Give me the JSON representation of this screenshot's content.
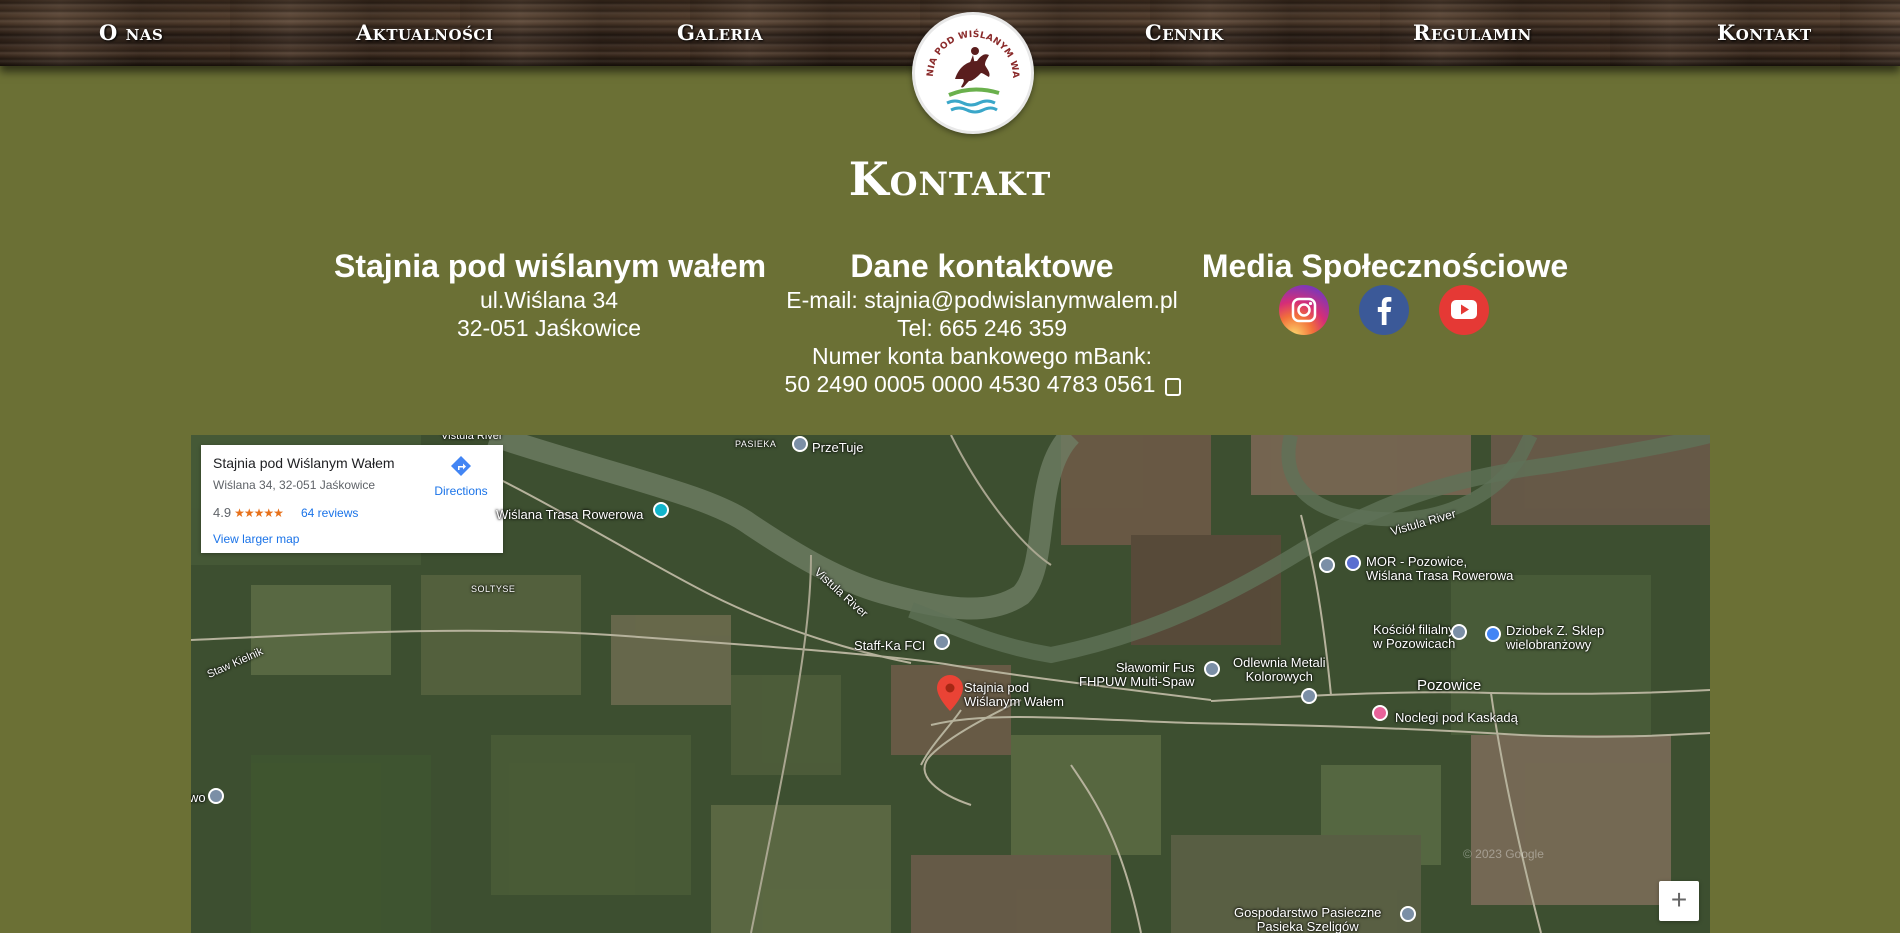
{
  "nav": {
    "items": [
      {
        "label": "O nas"
      },
      {
        "label": "Aktualności"
      },
      {
        "label": "Galeria"
      },
      {
        "label": "Cennik"
      },
      {
        "label": "Regulamin"
      },
      {
        "label": "Kontakt"
      }
    ],
    "logo_text": "STAJNIA POD WIŚLANYM WAŁEM"
  },
  "page_title": "Kontakt",
  "address": {
    "heading": "Stajnia pod wiślanym wałem",
    "street": "ul.Wiślana 34",
    "city": "32-051 Jaśkowice"
  },
  "contact": {
    "heading": "Dane kontaktowe",
    "email": "E-mail: stajnia@podwislanymwalem.pl",
    "phone": "Tel: 665 246 359",
    "bank_label": "Numer konta bankowego mBank:",
    "bank_account": "50 2490 0005 0000 4530 4783 0561"
  },
  "social": {
    "heading": "Media Społecznościowe",
    "icons": [
      "instagram-icon",
      "facebook-icon",
      "youtube-icon"
    ]
  },
  "map": {
    "place_name": "Stajnia pod Wiślanym Wałem",
    "place_address": "Wiślana 34, 32-051 Jaśkowice",
    "rating": "4.9",
    "stars": "★★★★★",
    "reviews": "64 reviews",
    "directions": "Directions",
    "view_larger": "View larger map",
    "zoom_in": "+",
    "labels": {
      "vistula_top": "Vistula River",
      "pasieka": "PASIEKA",
      "przetuje": "PrzeTuje",
      "trasa": "Wiślana Trasa Rowerowa",
      "soltyse": "SOLTYSE",
      "vistula_mid": "Vistula River",
      "vistula_right": "Vistula River",
      "staff": "Staff-Ka FCI",
      "stajnia": "Stajnia pod\nWiślanym Wałem",
      "slawomir": "Sławomir Fus\nFHPUW Multi-Spaw",
      "odlewnia": "Odlewnia Metali\nKolorowych",
      "mor": "MOR - Pozowice,\nWiślana Trasa Rowerowa",
      "kosciol": "Kościół filialny\nw Pozowicach",
      "dziobek": "Dziobek Z. Sklep\nwielobranżowy",
      "pozowice": "Pozowice",
      "noclegi": "Noclegi pod Kaskadą",
      "staw": "Staw Kielnik",
      "wo": "wo",
      "gospodarstwo": "Gospodarstwo Pasieczne\nPasieka Szeligów",
      "copyright": "© 2023 Google"
    }
  },
  "colors": {
    "background": "#6b7035",
    "link_blue": "#1a73e8",
    "star_orange": "#e7711b",
    "pin_red": "#ea4335"
  }
}
